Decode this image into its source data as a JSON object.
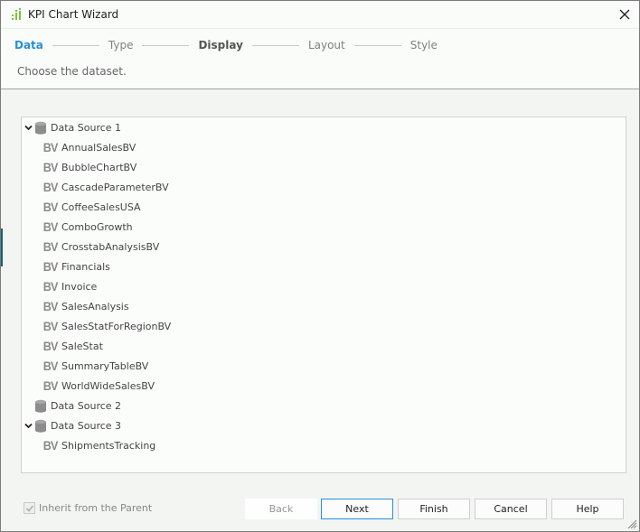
{
  "window": {
    "title": "KPI Chart Wizard",
    "accent_color": "#2a8fd6"
  },
  "wizard": {
    "steps": [
      {
        "label": "Data",
        "state": "active"
      },
      {
        "label": "Type",
        "state": "inactive"
      },
      {
        "label": "Display",
        "state": "bold"
      },
      {
        "label": "Layout",
        "state": "inactive"
      },
      {
        "label": "Style",
        "state": "inactive"
      }
    ],
    "instruction": "Choose the dataset."
  },
  "tree": {
    "data_sources": [
      {
        "label": "Data Source 1",
        "expanded": true,
        "icon": "database-icon",
        "views": [
          "AnnualSalesBV",
          "BubbleChartBV",
          "CascadeParameterBV",
          "CoffeeSalesUSA",
          "ComboGrowth",
          "CrosstabAnalysisBV",
          "Financials",
          "Invoice",
          "SalesAnalysis",
          "SalesStatForRegionBV",
          "SaleStat",
          "SummaryTableBV",
          "WorldWideSalesBV"
        ]
      },
      {
        "label": "Data Source 2",
        "expanded": false,
        "icon": "database-icon",
        "views": []
      },
      {
        "label": "Data Source 3",
        "expanded": true,
        "icon": "database-icon",
        "views": [
          "ShipmentsTracking"
        ]
      }
    ],
    "view_icon_text": "BV"
  },
  "footer": {
    "inherit_label": "Inherit from the Parent",
    "inherit_checked": true,
    "inherit_enabled": false,
    "buttons": {
      "back": "Back",
      "next": "Next",
      "finish": "Finish",
      "cancel": "Cancel",
      "help": "Help"
    }
  }
}
